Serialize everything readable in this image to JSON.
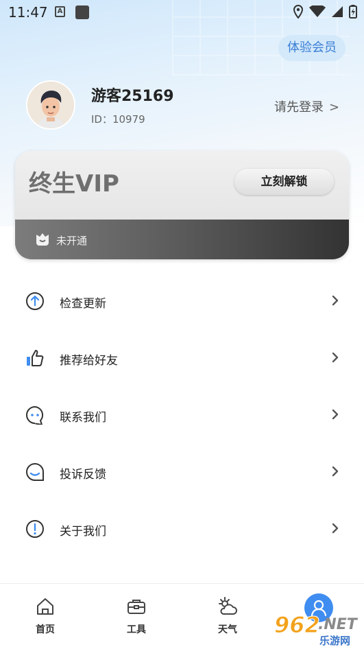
{
  "status_bar": {
    "time": "11:47",
    "notif_icon": "A",
    "icons": [
      "location-icon",
      "wifi-icon",
      "signal-icon",
      "battery-icon"
    ]
  },
  "header": {
    "trial_button": "体验会员"
  },
  "profile": {
    "username": "游客25169",
    "id_text": "ID：10979",
    "login_link": "请先登录",
    "chevron": ">"
  },
  "vip_card": {
    "title": "终生VIP",
    "unlock_button": "立刻解锁",
    "status": "未开通"
  },
  "menu": {
    "items": [
      {
        "label": "检查更新",
        "icon": "arrow-up-circle-icon"
      },
      {
        "label": "推荐给好友",
        "icon": "thumbs-up-icon"
      },
      {
        "label": "联系我们",
        "icon": "chat-bubble-icon"
      },
      {
        "label": "投诉反馈",
        "icon": "feedback-icon"
      },
      {
        "label": "关于我们",
        "icon": "info-exclamation-icon"
      }
    ]
  },
  "bottom_nav": {
    "items": [
      {
        "label": "首页",
        "icon": "home-icon"
      },
      {
        "label": "工具",
        "icon": "toolbox-icon"
      },
      {
        "label": "天气",
        "icon": "weather-icon"
      },
      {
        "label": "",
        "icon": "profile-icon"
      }
    ]
  },
  "watermark": {
    "num": "962",
    "net": ".NET",
    "sub": "乐游网"
  },
  "colors": {
    "accent_blue": "#3f8df0",
    "trial_text": "#3a7ed6"
  }
}
